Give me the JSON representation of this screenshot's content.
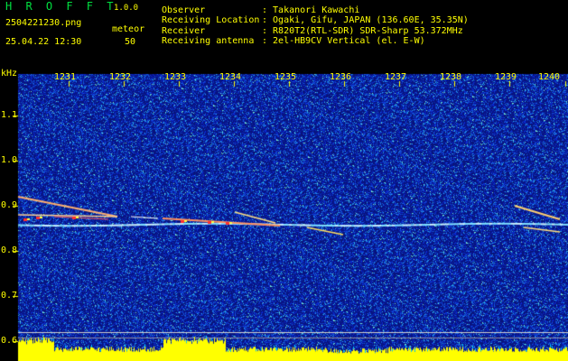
{
  "header": {
    "app_title": "H R O F F T",
    "version": "1.0.0",
    "filename": "2504221230.png",
    "meteor_label": "meteor",
    "datetime": "25.04.22 12:30",
    "meteor_count": "50",
    "fields": [
      {
        "label": "Observer",
        "value": ": Takanori Kawachi"
      },
      {
        "label": "Receiving Location",
        "value": ": Ogaki, Gifu, JAPAN (136.60E, 35.35N)"
      },
      {
        "label": "Receiver",
        "value": ": R820T2(RTL-SDR) SDR-Sharp 53.372MHz"
      },
      {
        "label": "Receiving antenna",
        "value": ": 2el-HB9CV Vertical (el. E-W)"
      }
    ]
  },
  "plot": {
    "y_unit": "kHz",
    "y_ticks": [
      "1.1",
      "1.0",
      "0.9",
      "0.8",
      "0.7",
      "0.6"
    ],
    "x_ticks": [
      "1231",
      "1232",
      "1233",
      "1234",
      "1235",
      "1236",
      "1237",
      "1238",
      "1239",
      "1240"
    ]
  },
  "colors": {
    "background": "#000000",
    "spectrogram_base": "#0a1a6e",
    "label_yellow": "#ffff00",
    "title_green": "#00e040"
  }
}
